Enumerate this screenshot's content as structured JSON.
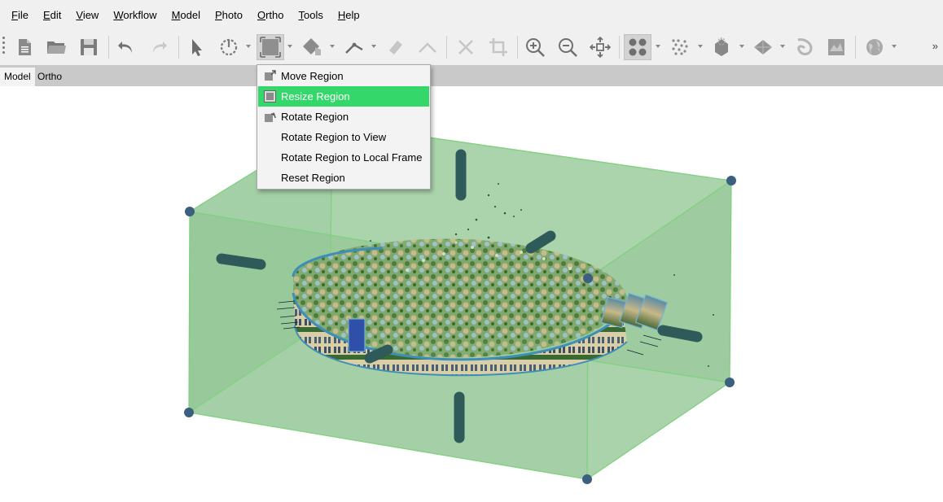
{
  "menubar": {
    "items": [
      {
        "key": "F",
        "rest": "ile"
      },
      {
        "key": "E",
        "rest": "dit"
      },
      {
        "key": "V",
        "rest": "iew"
      },
      {
        "key": "W",
        "rest": "orkflow"
      },
      {
        "key": "M",
        "rest": "odel"
      },
      {
        "key": "P",
        "rest": "hoto"
      },
      {
        "key": "O",
        "rest": "rtho"
      },
      {
        "key": "T",
        "rest": "ools"
      },
      {
        "key": "H",
        "rest": "elp"
      }
    ]
  },
  "toolbar": {
    "overflow": "»"
  },
  "tabs": [
    {
      "label": "Model"
    },
    {
      "label": "Ortho"
    }
  ],
  "region_menu": {
    "items": [
      {
        "label": "Move Region",
        "icon": "move-region-icon"
      },
      {
        "label": "Resize Region",
        "icon": "resize-region-icon"
      },
      {
        "label": "Rotate Region",
        "icon": "rotate-region-icon"
      },
      {
        "label": "Rotate Region to View"
      },
      {
        "label": "Rotate Region to Local Frame"
      },
      {
        "label": "Reset Region"
      }
    ]
  },
  "colors": {
    "highlight": "#33d76a",
    "region_fill": "#9ccc9e",
    "region_edge": "#7fd17f",
    "handle": "#3b5f7e"
  }
}
